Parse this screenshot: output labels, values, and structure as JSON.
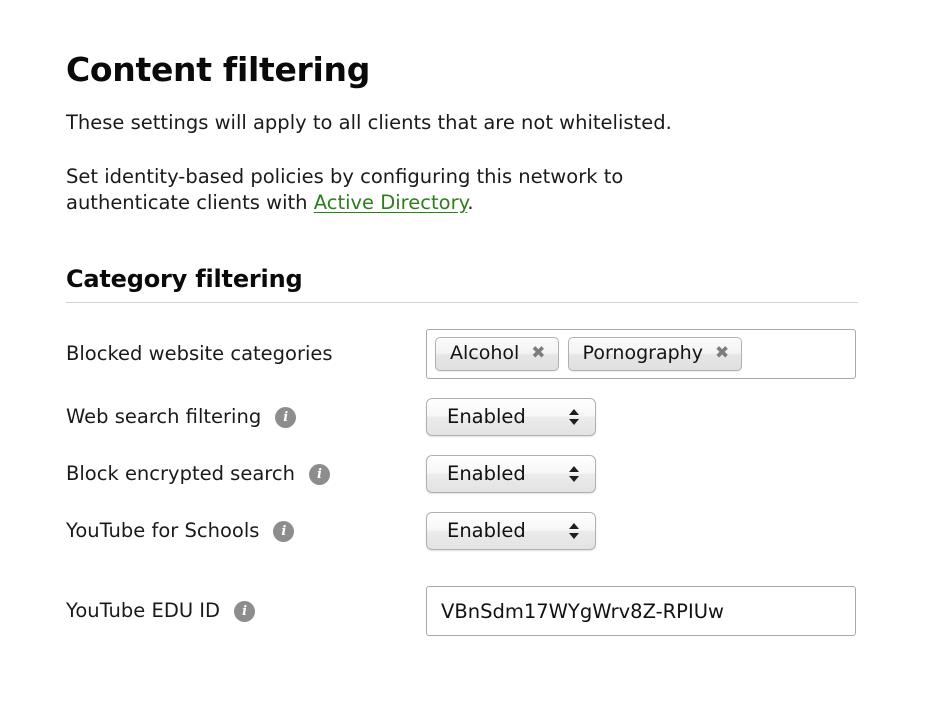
{
  "header": {
    "title": "Content filtering",
    "intro_line_1": "These settings will apply to all clients that are not whitelisted.",
    "intro_line_2_before": "Set identity-based policies by configuring this network to",
    "intro_line_3_before": "authenticate clients with ",
    "active_directory_link": "Active Directory",
    "intro_line_3_after": "."
  },
  "section": {
    "title": "Category filtering"
  },
  "fields": {
    "blocked_categories": {
      "label": "Blocked website categories",
      "tags": [
        {
          "label": "Alcohol",
          "remove_icon": "close-icon"
        },
        {
          "label": "Pornography",
          "remove_icon": "close-icon"
        }
      ]
    },
    "web_search_filtering": {
      "label": "Web search filtering",
      "info_icon": "info-icon",
      "value": "Enabled"
    },
    "block_encrypted_search": {
      "label": "Block encrypted search",
      "info_icon": "info-icon",
      "value": "Enabled"
    },
    "youtube_for_schools": {
      "label": "YouTube for Schools",
      "info_icon": "info-icon",
      "value": "Enabled"
    },
    "youtube_edu_id": {
      "label": "YouTube EDU ID",
      "info_icon": "info-icon",
      "value": "VBnSdm17WYgWrv8Z-RPIUw",
      "placeholder": ""
    }
  },
  "colors": {
    "link_green": "#2e7d1e",
    "info_icon_gray": "#8d8d8d",
    "rule_gray": "#d4d4d4",
    "field_border": "#a9a9a9"
  }
}
